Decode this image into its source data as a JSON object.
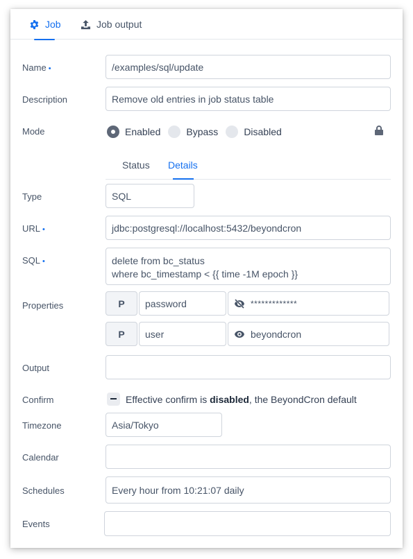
{
  "tabs": [
    {
      "label": "Job",
      "icon": "gear-icon",
      "active": true
    },
    {
      "label": "Job output",
      "icon": "upload-icon",
      "active": false
    }
  ],
  "colors": {
    "accent": "#1570ef",
    "text": "#475467",
    "border": "#cfd4dc"
  },
  "form": {
    "name": {
      "label": "Name",
      "required": true,
      "value": "/examples/sql/update"
    },
    "description": {
      "label": "Description",
      "value": "Remove old entries in job status table"
    },
    "mode": {
      "label": "Mode",
      "options": [
        "Enabled",
        "Bypass",
        "Disabled"
      ],
      "selected": "Enabled",
      "lock_icon": "lock-icon"
    },
    "subtabs": [
      {
        "label": "Status",
        "active": false
      },
      {
        "label": "Details",
        "active": true
      }
    ],
    "type": {
      "label": "Type",
      "value": "SQL"
    },
    "url": {
      "label": "URL",
      "required": true,
      "value": "jdbc:postgresql://localhost:5432/beyondcron"
    },
    "sql": {
      "label": "SQL",
      "required": true,
      "lines": [
        "delete from bc_status",
        "where bc_timestamp < {{ time -1M epoch }}"
      ]
    },
    "properties": {
      "label": "Properties",
      "items": [
        {
          "kind": "P",
          "key": "password",
          "value": "*************",
          "visibility_icon": "eye-off-icon"
        },
        {
          "kind": "P",
          "key": "user",
          "value": "beyondcron",
          "visibility_icon": "eye-icon"
        }
      ]
    },
    "output": {
      "label": "Output",
      "value": ""
    },
    "confirm": {
      "label": "Confirm",
      "text_prefix": "Effective confirm is ",
      "text_bold": "disabled",
      "text_suffix": ", the BeyondCron default"
    },
    "timezone": {
      "label": "Timezone",
      "value": "Asia/Tokyo"
    },
    "calendar": {
      "label": "Calendar",
      "value": ""
    },
    "schedules": {
      "label": "Schedules",
      "value": "Every hour from 10:21:07 daily"
    },
    "events": {
      "label": "Events",
      "value": ""
    },
    "required_marker": "•"
  }
}
